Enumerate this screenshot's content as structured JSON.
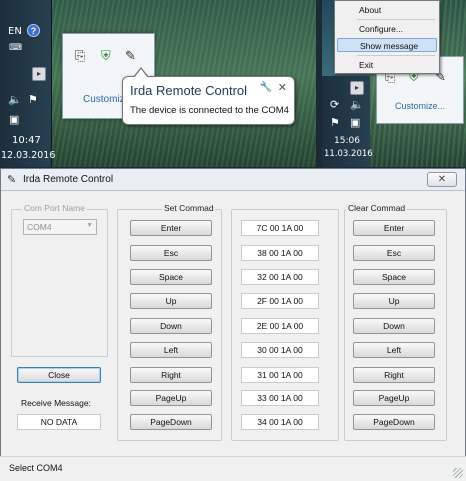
{
  "taskbar_left": {
    "language": "EN",
    "time": "10:47",
    "date": "12.03.2016",
    "customize_label": "Customiz"
  },
  "balloon": {
    "title": "Irda Remote Control",
    "message": "The device is connected to the COM4"
  },
  "context_menu": {
    "items": [
      "About",
      "Configure...",
      "Show message",
      "Exit"
    ],
    "highlighted": "Show message"
  },
  "taskbar_right": {
    "time": "15:06",
    "date": "11.03.2016",
    "customize_label": "Customize..."
  },
  "window": {
    "title": "Irda Remote Control",
    "com_port_label": "Com Port Name",
    "com_port_value": "COM4",
    "close_label": "Close",
    "receive_label": "Receive Message:",
    "receive_value": "NO DATA",
    "set_header": "Set Commad",
    "clear_header": "Clear Commad",
    "commands": [
      {
        "name": "Enter",
        "code": "7C 00 1A 00"
      },
      {
        "name": "Esc",
        "code": "38 00 1A 00"
      },
      {
        "name": "Space",
        "code": "32 00 1A 00"
      },
      {
        "name": "Up",
        "code": "2F 00 1A 00"
      },
      {
        "name": "Down",
        "code": "2E 00 1A 00"
      },
      {
        "name": "Left",
        "code": "30 00 1A 00"
      },
      {
        "name": "Right",
        "code": "31 00 1A 00"
      },
      {
        "name": "PageUp",
        "code": "33 00 1A 00"
      },
      {
        "name": "PageDown",
        "code": "34 00 1A 00"
      }
    ],
    "status": "Select COM4"
  }
}
